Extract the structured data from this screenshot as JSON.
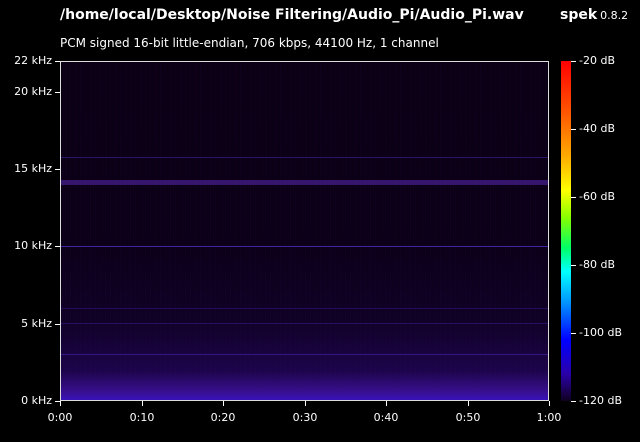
{
  "header": {
    "file_path": "/home/local/Desktop/Noise Filtering/Audio_Pi/Audio_Pi.wav",
    "app_name": "spek",
    "app_version": "0.8.2",
    "info": "PCM signed 16-bit little-endian, 706 kbps, 44100 Hz, 1 channel"
  },
  "y_axis": {
    "ticks": [
      {
        "label": "22 kHz",
        "value": 22
      },
      {
        "label": "20 kHz",
        "value": 20
      },
      {
        "label": "15 kHz",
        "value": 15
      },
      {
        "label": "10 kHz",
        "value": 10
      },
      {
        "label": "5 kHz",
        "value": 5
      },
      {
        "label": "0 kHz",
        "value": 0
      }
    ],
    "range": [
      0,
      22
    ]
  },
  "x_axis": {
    "ticks": [
      {
        "label": "0:00",
        "value": 0
      },
      {
        "label": "0:10",
        "value": 10
      },
      {
        "label": "0:20",
        "value": 20
      },
      {
        "label": "0:30",
        "value": 30
      },
      {
        "label": "0:40",
        "value": 40
      },
      {
        "label": "0:50",
        "value": 50
      },
      {
        "label": "1:00",
        "value": 60
      }
    ],
    "range": [
      0,
      60
    ]
  },
  "colorbar": {
    "ticks": [
      {
        "label": "-20 dB",
        "value": -20
      },
      {
        "label": "-40 dB",
        "value": -40
      },
      {
        "label": "-60 dB",
        "value": -60
      },
      {
        "label": "-80 dB",
        "value": -80
      },
      {
        "label": "-100 dB",
        "value": -100
      },
      {
        "label": "-120 dB",
        "value": -120
      }
    ],
    "range": [
      -120,
      -20
    ]
  }
}
